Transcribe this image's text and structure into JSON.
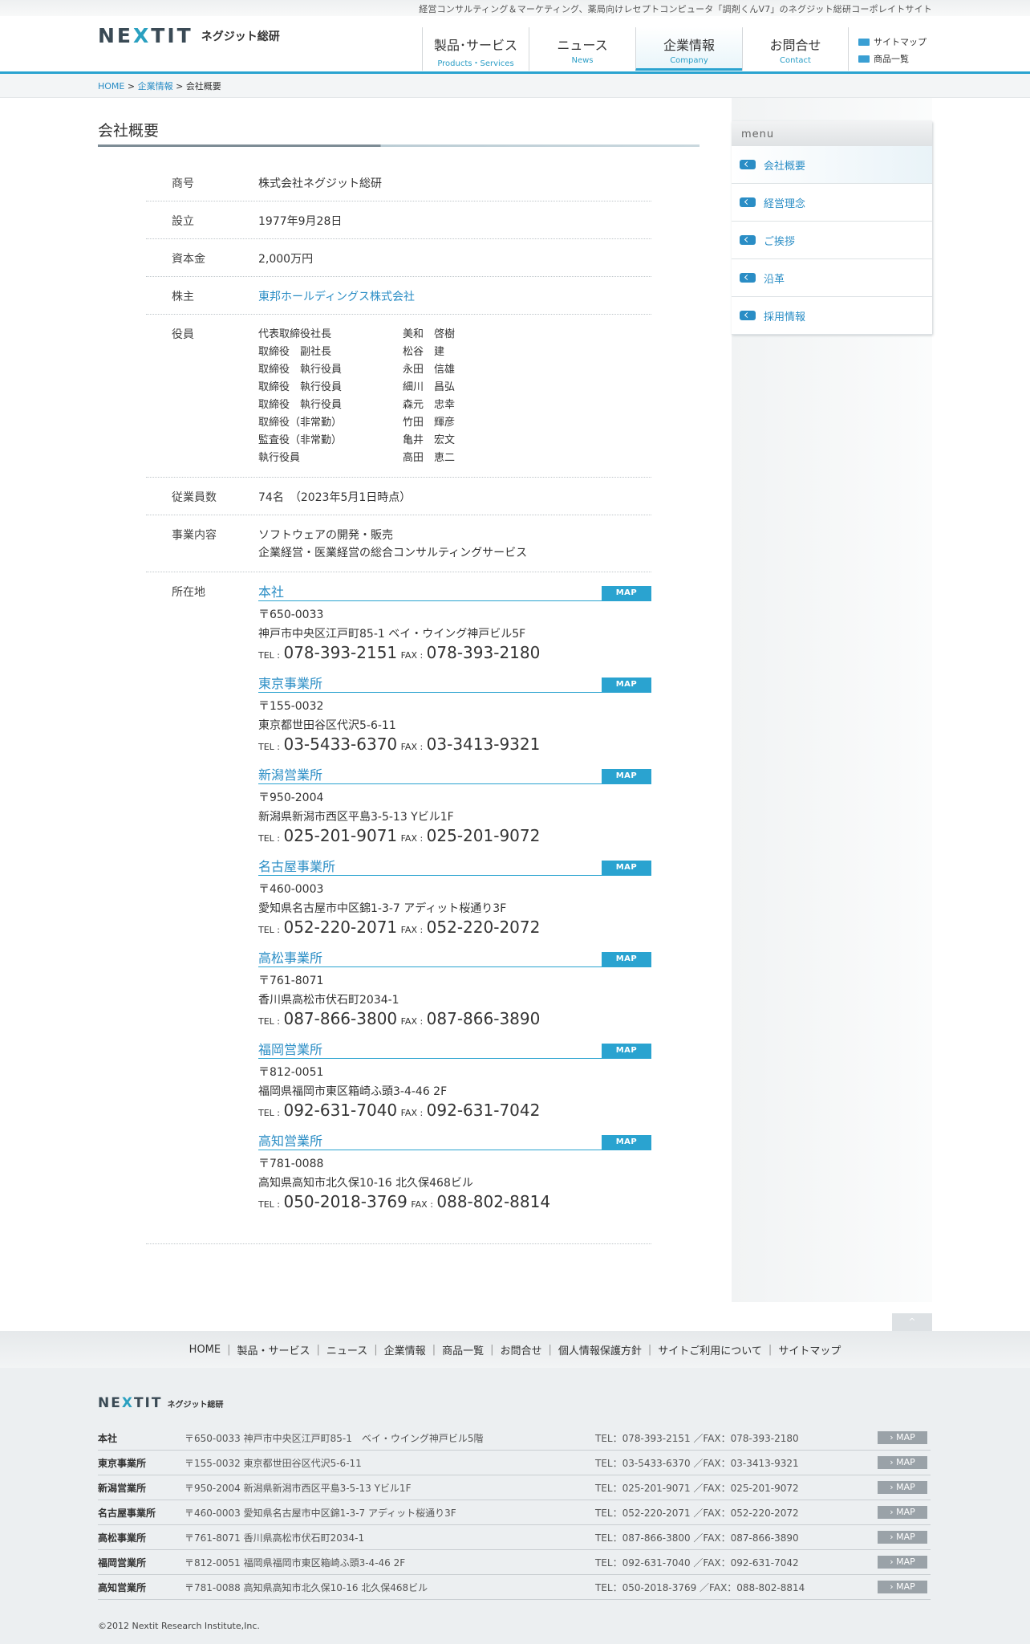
{
  "header": {
    "tagline": "経営コンサルティング＆マーケティング、薬局向けレセプトコンピュータ「調剤くんV7」のネグジット総研コーポレイトサイト",
    "logo_mark_a": "NE",
    "logo_mark_x": "X",
    "logo_mark_b": "TIT",
    "logo_kana": "ネグジット総研",
    "nav": [
      {
        "jp": "製品･サービス",
        "en": "Products・Services"
      },
      {
        "jp": "ニュース",
        "en": "News"
      },
      {
        "jp": "企業情報",
        "en": "Company"
      },
      {
        "jp": "お問合せ",
        "en": "Contact"
      }
    ],
    "util": [
      "サイトマップ",
      "商品一覧"
    ]
  },
  "breadcrumb": {
    "home": "HOME",
    "company": "企業情報",
    "current": "会社概要"
  },
  "page_title": "会社概要",
  "info": {
    "name_lbl": "商号",
    "name": "株式会社ネグジット総研",
    "est_lbl": "設立",
    "est": "1977年9月28日",
    "cap_lbl": "資本金",
    "cap": "2,000万円",
    "sh_lbl": "株主",
    "sh": "東邦ホールディングス株式会社",
    "off_lbl": "役員",
    "officers": [
      [
        "代表取締役社長",
        "美和　啓樹"
      ],
      [
        "取締役　副社長",
        "松谷　建"
      ],
      [
        "取締役　執行役員",
        "永田　信雄"
      ],
      [
        "取締役　執行役員",
        "細川　昌弘"
      ],
      [
        "取締役　執行役員",
        "森元　忠幸"
      ],
      [
        "取締役（非常勤）",
        "竹田　輝彦"
      ],
      [
        "監査役（非常勤）",
        "亀井　宏文"
      ],
      [
        "執行役員",
        "高田　恵二"
      ]
    ],
    "emp_lbl": "従業員数",
    "emp": "74名　（2023年5月1日時点）",
    "biz_lbl": "事業内容",
    "biz1": "ソフトウェアの開発・販売",
    "biz2": "企業経営・医業経営の総合コンサルティングサービス",
    "loc_lbl": "所在地"
  },
  "map_label": "MAP",
  "tel_lbl": "TEL :",
  "fax_lbl": "FAX :",
  "offices": [
    {
      "name": "本社",
      "zip": "〒650-0033",
      "addr": "神戸市中央区江戸町85-1 ベイ・ウイング神戸ビル5F",
      "tel": "078-393-2151",
      "fax": "078-393-2180"
    },
    {
      "name": "東京事業所",
      "zip": "〒155-0032",
      "addr": "東京都世田谷区代沢5-6-11",
      "tel": "03-5433-6370",
      "fax": "03-3413-9321"
    },
    {
      "name": "新潟営業所",
      "zip": "〒950-2004",
      "addr": "新潟県新潟市西区平島3-5-13 Yビル1F",
      "tel": "025-201-9071",
      "fax": "025-201-9072"
    },
    {
      "name": "名古屋事業所",
      "zip": "〒460-0003",
      "addr": "愛知県名古屋市中区錦1-3-7 アディット桜通り3F",
      "tel": "052-220-2071",
      "fax": "052-220-2072"
    },
    {
      "name": "高松事業所",
      "zip": "〒761-8071",
      "addr": "香川県高松市伏石町2034-1",
      "tel": "087-866-3800",
      "fax": "087-866-3890"
    },
    {
      "name": "福岡営業所",
      "zip": "〒812-0051",
      "addr": "福岡県福岡市東区箱崎ふ頭3-4-46 2F",
      "tel": "092-631-7040",
      "fax": "092-631-7042"
    },
    {
      "name": "高知営業所",
      "zip": "〒781-0088",
      "addr": "高知県高知市北久保10-16 北久保468ビル",
      "tel": "050-2018-3769",
      "fax": "088-802-8814"
    }
  ],
  "side_menu": {
    "title": "menu",
    "items": [
      "会社概要",
      "経営理念",
      "ご挨拶",
      "沿革",
      "採用情報"
    ]
  },
  "pagetop": "^",
  "footer": {
    "nav": [
      "HOME",
      "製品・サービス",
      "ニュース",
      "企業情報",
      "商品一覧",
      "お問合せ",
      "個人情報保護方針",
      "サイトご利用について",
      "サイトマップ"
    ],
    "rows": [
      {
        "n": "本社",
        "a": "〒650-0033 神戸市中央区江戸町85-1　ベイ・ウイング神戸ビル5階",
        "t": "TEL：078-393-2151 ／FAX：078-393-2180"
      },
      {
        "n": "東京事業所",
        "a": "〒155-0032 東京都世田谷区代沢5-6-11",
        "t": "TEL：03-5433-6370 ／FAX：03-3413-9321"
      },
      {
        "n": "新潟営業所",
        "a": "〒950-2004 新潟県新潟市西区平島3-5-13 Yビル1F",
        "t": "TEL：025-201-9071 ／FAX：025-201-9072"
      },
      {
        "n": "名古屋事業所",
        "a": "〒460-0003 愛知県名古屋市中区錦1-3-7 アディット桜通り3F",
        "t": "TEL：052-220-2071 ／FAX：052-220-2072"
      },
      {
        "n": "高松事業所",
        "a": "〒761-8071 香川県高松市伏石町2034-1",
        "t": "TEL：087-866-3800 ／FAX：087-866-3890"
      },
      {
        "n": "福岡営業所",
        "a": "〒812-0051 福岡県福岡市東区箱崎ふ頭3-4-46 2F",
        "t": "TEL：092-631-7040 ／FAX：092-631-7042"
      },
      {
        "n": "高知営業所",
        "a": "〒781-0088 高知県高知市北久保10-16 北久保468ビル",
        "t": "TEL：050-2018-3769 ／FAX：088-802-8814"
      }
    ],
    "copyright": "©2012 Nextit Research Institute,Inc."
  }
}
